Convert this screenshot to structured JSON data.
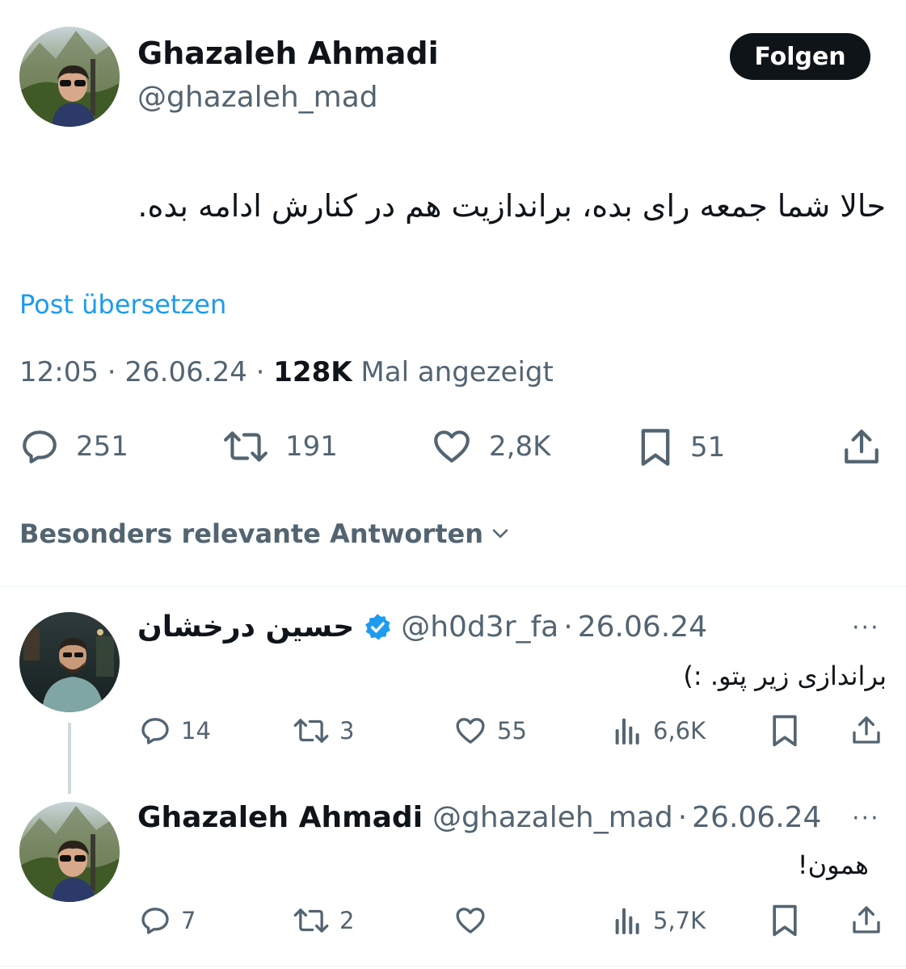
{
  "tweet": {
    "author_name": "Ghazaleh Ahmadi",
    "author_handle": "@ghazaleh_mad",
    "follow_label": "Folgen",
    "text": "حالا شما جمعه رای بده، براندازیت هم در کنارش ادامه بده.",
    "translate_label": "Post übersetzen",
    "time": "12:05",
    "date": "26.06.24",
    "views_count": "128K",
    "views_label": "Mal angezeigt",
    "separator": "·",
    "stats": {
      "replies": "251",
      "reposts": "191",
      "likes": "2,8K",
      "bookmarks": "51"
    }
  },
  "sort_label": "Besonders relevante Antworten",
  "replies": [
    {
      "author_name": "حسین درخشان",
      "verified": true,
      "author_handle": "@h0d3r_fa",
      "date": "26.06.24",
      "text": "براندازی زیر پتو. :)",
      "replies": "14",
      "reposts": "3",
      "likes": "55",
      "views": "6,6K",
      "more": "···"
    },
    {
      "author_name": "Ghazaleh Ahmadi",
      "author_handle": "@ghazaleh_mad",
      "date": "26.06.24",
      "text": "همون!",
      "replies": "7",
      "reposts": "2",
      "likes": "",
      "views": "5,7K",
      "more": "···"
    }
  ],
  "icons": {
    "reply": "reply-icon",
    "repost": "repost-icon",
    "like": "heart-icon",
    "bookmark": "bookmark-icon",
    "share": "share-icon",
    "views": "views-icon",
    "verified": "verified-badge-icon",
    "chevron": "chevron-down-icon"
  },
  "colors": {
    "text": "#0f1419",
    "secondary": "#536471",
    "link": "#1d9bf0",
    "verified": "#1d9bf0",
    "button_bg": "#0f1419"
  }
}
